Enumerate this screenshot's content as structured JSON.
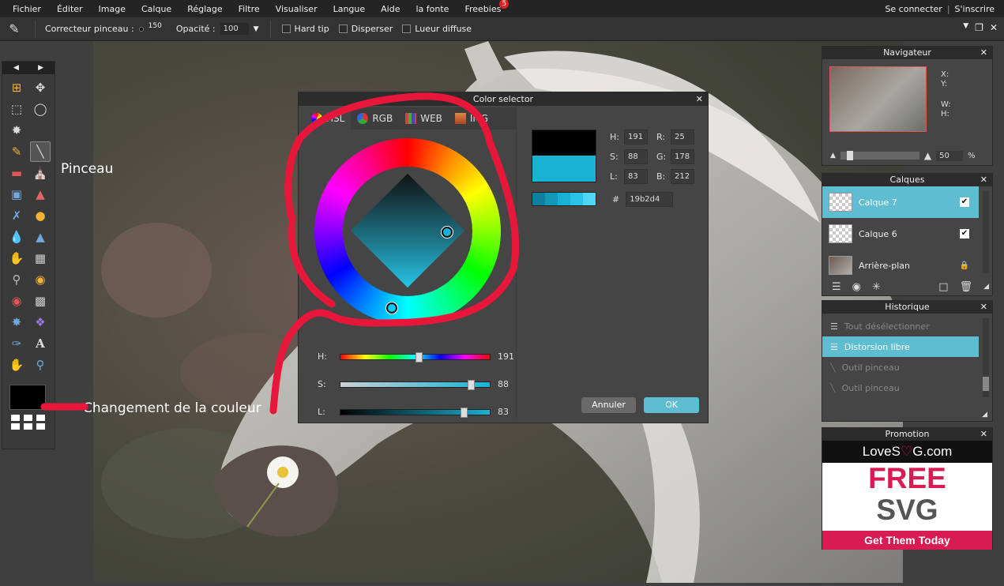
{
  "menu": {
    "items": [
      "Fichier",
      "Éditer",
      "Image",
      "Calque",
      "Réglage",
      "Filtre",
      "Visualiser",
      "Langue",
      "Aide",
      "la fonte",
      "Freebies"
    ],
    "freebies_badge": "5",
    "login": "Se connecter",
    "signup": "S'inscrire"
  },
  "options": {
    "brush_label": "Correcteur pinceau :",
    "brush_size": "150",
    "opacity_label": "Opacité :",
    "opacity_value": "100",
    "hard_tip": "Hard tip",
    "scatter": "Disperser",
    "glow": "Lueur diffuse"
  },
  "annotations": {
    "pinceau": "Pinceau",
    "color_change": "Changement de la couleur"
  },
  "color_selector": {
    "title": "Color selector",
    "tabs": [
      "HSL",
      "RGB",
      "WEB",
      "IMG"
    ],
    "h_label": "H:",
    "s_label": "S:",
    "l_label": "L:",
    "h_value": "191",
    "s_value": "88",
    "l_value": "83",
    "h_fraction": 0.53,
    "s_fraction": 0.88,
    "l_fraction": 0.83,
    "r_label": "R:",
    "g_label": "G:",
    "b_label": "B:",
    "r_value": "25",
    "g_value": "178",
    "b_value": "212",
    "hash_label": "#",
    "hex_value": "19b2d4",
    "cancel": "Annuler",
    "ok": "OK",
    "current_color": "#19b2d4",
    "previous_color": "#000000"
  },
  "navigator": {
    "title": "Navigateur",
    "x_label": "X:",
    "y_label": "Y:",
    "w_label": "W:",
    "h_label": "H:",
    "zoom": "50",
    "zoom_unit": "%"
  },
  "layers": {
    "title": "Calques",
    "items": [
      {
        "name": "Calque 7",
        "selected": true
      },
      {
        "name": "Calque 6",
        "selected": false
      },
      {
        "name": "Arrière-plan",
        "selected": false
      }
    ]
  },
  "history": {
    "title": "Historique",
    "items": [
      "Tout désélectionner",
      "Distorsion libre",
      "Outil pinceau",
      "Outil pinceau"
    ]
  },
  "promotion": {
    "title": "Promotion",
    "brand_prefix": "LoveS",
    "brand_suffix": "G.com",
    "free": "FREE",
    "svg": "SVG",
    "cta": "Get Them Today"
  },
  "colors": {
    "accent": "#5fbdd2",
    "annotation_red": "#e8173a",
    "promo_pink": "#d81b52"
  }
}
